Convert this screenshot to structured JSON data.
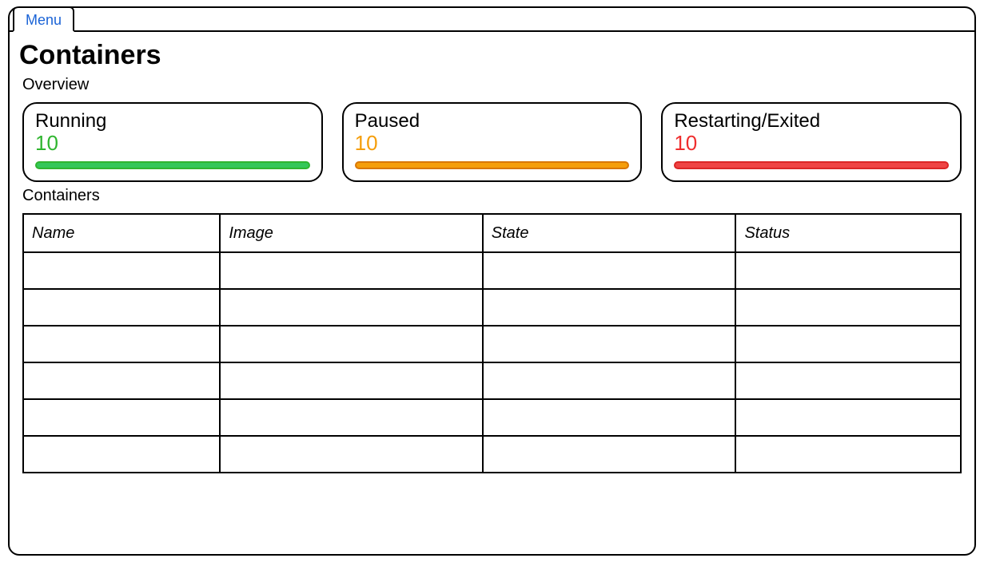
{
  "menu": {
    "label": "Menu"
  },
  "page": {
    "title": "Containers"
  },
  "overview": {
    "label": "Overview",
    "cards": [
      {
        "title": "Running",
        "count": "10",
        "color": "green"
      },
      {
        "title": "Paused",
        "count": "10",
        "color": "orange"
      },
      {
        "title": "Restarting/Exited",
        "count": "10",
        "color": "red"
      }
    ]
  },
  "containers": {
    "label": "Containers",
    "columns": [
      "Name",
      "Image",
      "State",
      "Status"
    ],
    "rows": [
      [
        "",
        "",
        "",
        ""
      ],
      [
        "",
        "",
        "",
        ""
      ],
      [
        "",
        "",
        "",
        ""
      ],
      [
        "",
        "",
        "",
        ""
      ],
      [
        "",
        "",
        "",
        ""
      ],
      [
        "",
        "",
        "",
        ""
      ]
    ]
  },
  "colors": {
    "green": "#2fb52f",
    "orange": "#f59e0b",
    "red": "#ef2e2e",
    "link": "#1a63d6"
  }
}
